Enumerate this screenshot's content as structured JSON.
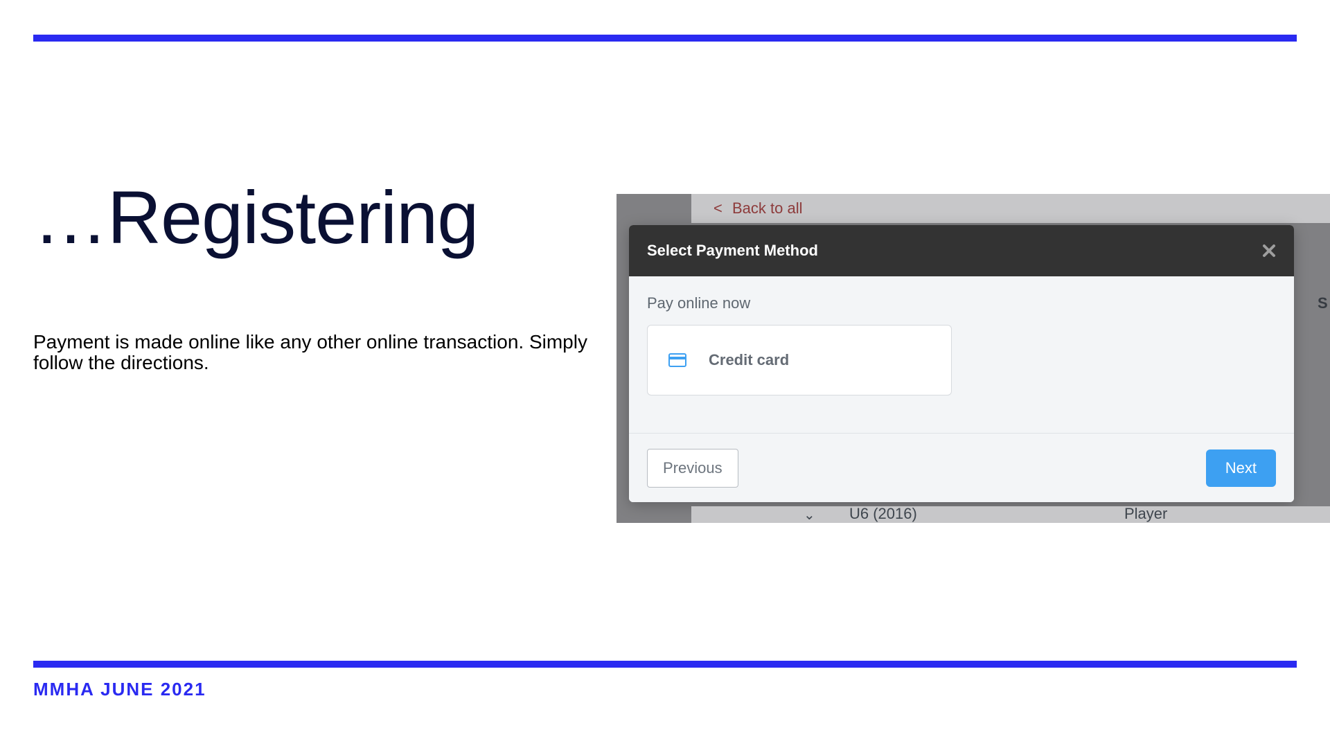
{
  "slide": {
    "title": "…Registering",
    "body": "Payment is made online like any other online transaction. Simply follow the directions.",
    "footer": "MMHA JUNE 2021"
  },
  "screenshot": {
    "back_link": "Back to all",
    "modal": {
      "header_title": "Select Payment Method",
      "pay_label": "Pay online now",
      "credit_card_label": "Credit card",
      "prev_button": "Previous",
      "next_button": "Next"
    },
    "background": {
      "row_item": "U6 (2016)",
      "row_role": "Player",
      "s_fragment": "S"
    }
  },
  "colors": {
    "accent": "#2a2af1",
    "next_button": "#3da0f2"
  }
}
